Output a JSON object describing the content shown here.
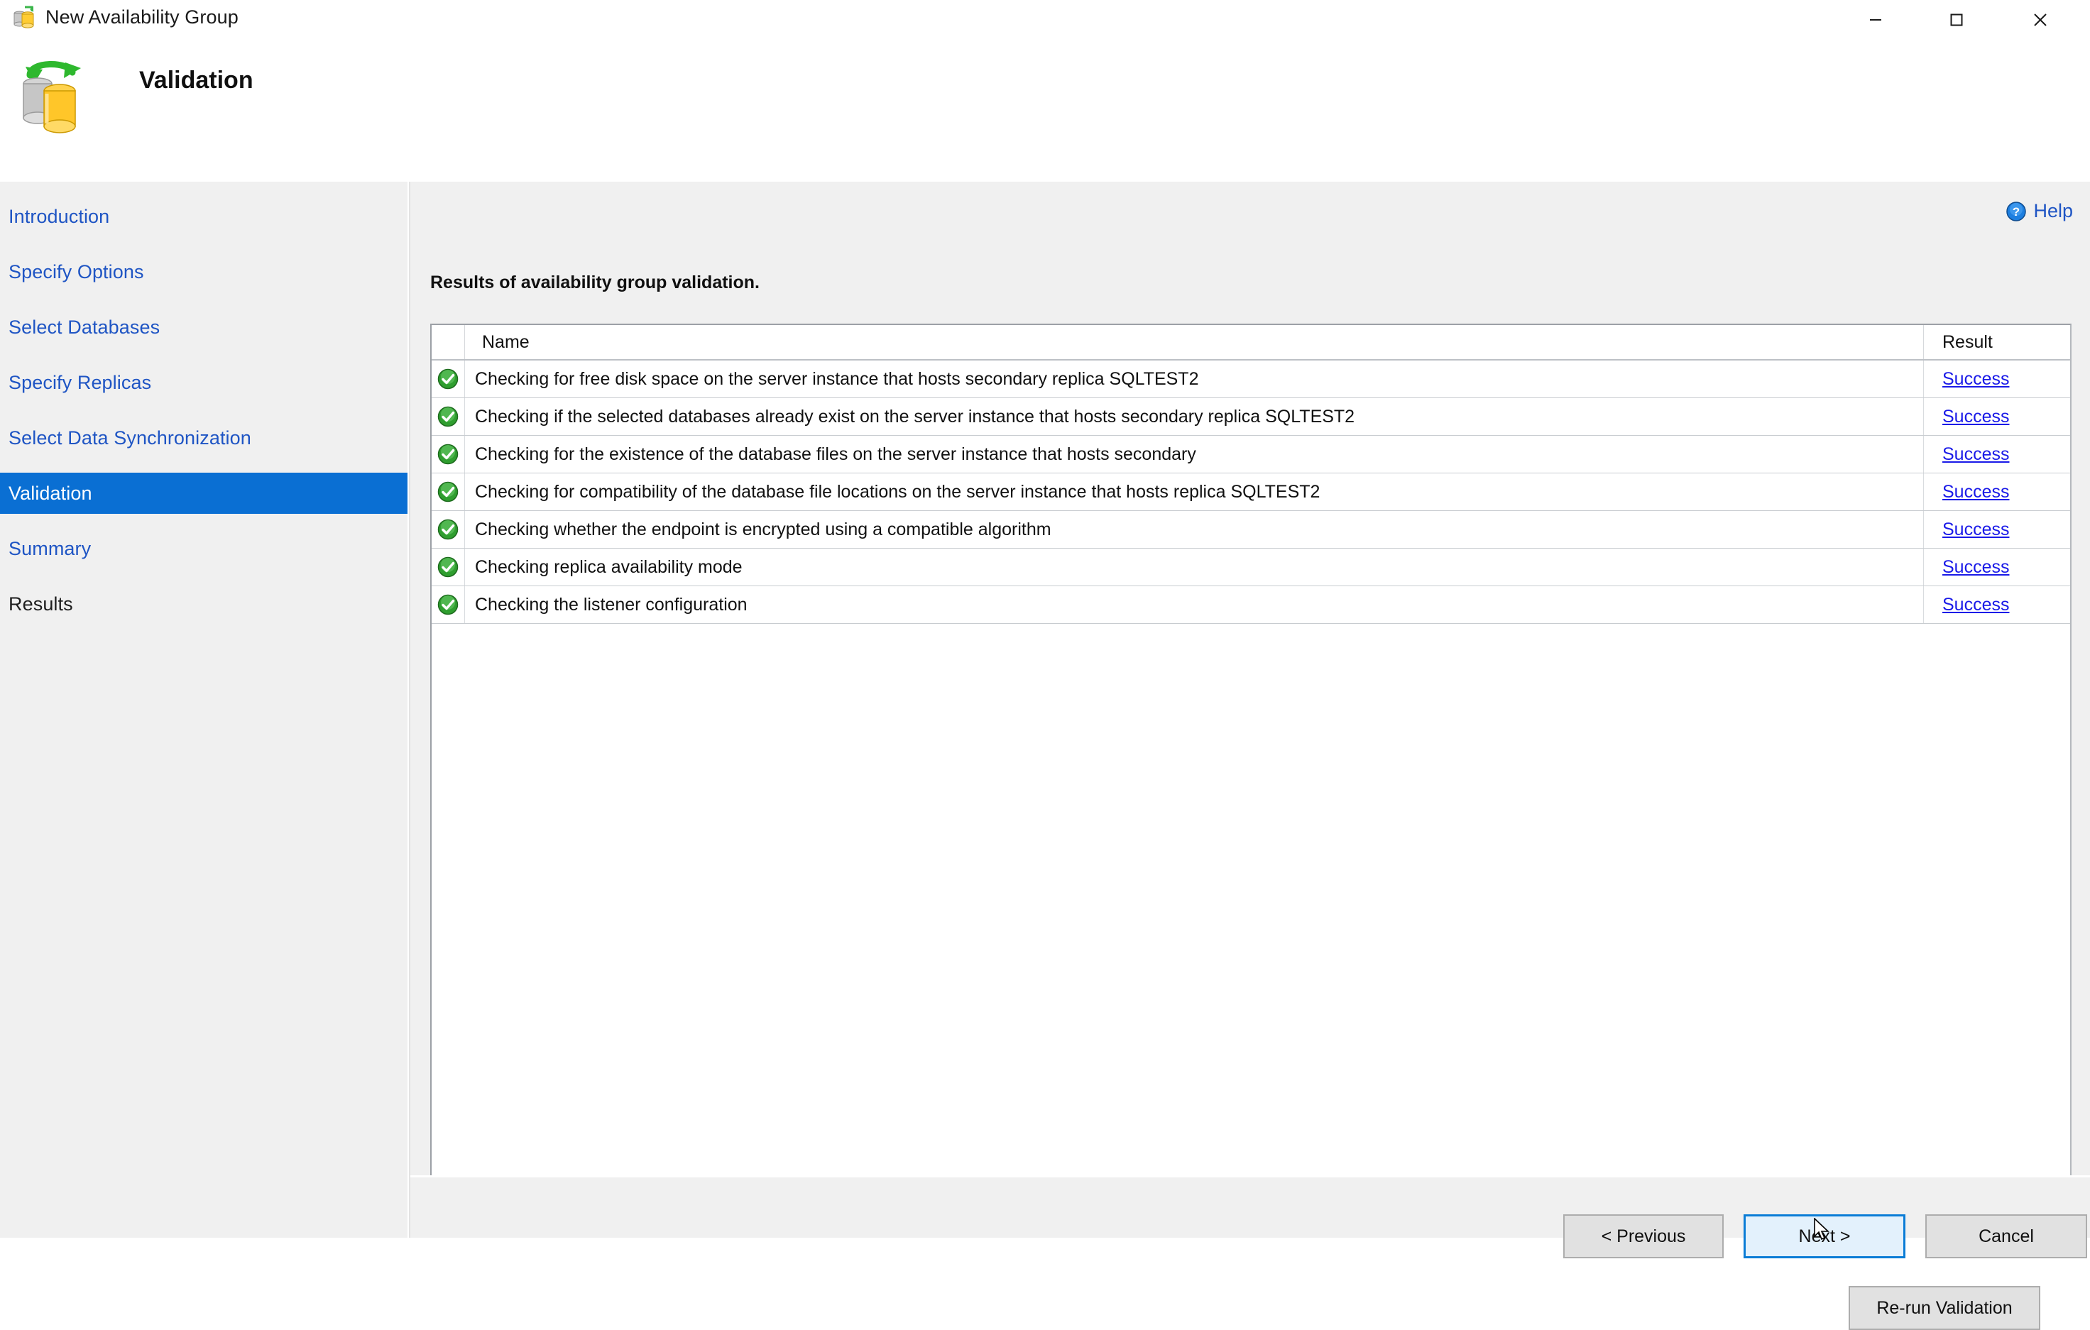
{
  "window": {
    "title": "New Availability Group",
    "icon": "availability-group-icon",
    "controls": {
      "minimize": "minimize-icon",
      "maximize": "maximize-icon",
      "close": "close-icon"
    }
  },
  "banner": {
    "title": "Validation",
    "icon": "database-replication-icon"
  },
  "sidebar": {
    "items": [
      {
        "label": "Introduction",
        "state": "link"
      },
      {
        "label": "Specify Options",
        "state": "link"
      },
      {
        "label": "Select Databases",
        "state": "link"
      },
      {
        "label": "Specify Replicas",
        "state": "link"
      },
      {
        "label": "Select Data Synchronization",
        "state": "link"
      },
      {
        "label": "Validation",
        "state": "active"
      },
      {
        "label": "Summary",
        "state": "link"
      },
      {
        "label": "Results",
        "state": "done"
      }
    ]
  },
  "content": {
    "help": {
      "label": "Help",
      "icon": "help-icon"
    },
    "section_title": "Results of availability group validation.",
    "table": {
      "columns": [
        "",
        "Name",
        "Result"
      ],
      "rows": [
        {
          "icon": "success-check-icon",
          "name": "Checking for free disk space on the server instance that hosts secondary replica SQLTEST2",
          "result": "Success"
        },
        {
          "icon": "success-check-icon",
          "name": "Checking if the selected databases already exist on the server instance that hosts secondary replica SQLTEST2",
          "result": "Success"
        },
        {
          "icon": "success-check-icon",
          "name": "Checking for the existence of the database files on the server instance that hosts secondary",
          "result": "Success"
        },
        {
          "icon": "success-check-icon",
          "name": "Checking for compatibility of the database file locations on the server instance that hosts replica SQLTEST2",
          "result": "Success"
        },
        {
          "icon": "success-check-icon",
          "name": "Checking whether the endpoint is encrypted using a compatible algorithm",
          "result": "Success"
        },
        {
          "icon": "success-check-icon",
          "name": "Checking replica availability mode",
          "result": "Success"
        },
        {
          "icon": "success-check-icon",
          "name": "Checking the listener configuration",
          "result": "Success"
        }
      ]
    },
    "rerun_button": "Re-run Validation"
  },
  "footer": {
    "previous": "< Previous",
    "next": "Next >",
    "cancel": "Cancel"
  },
  "colors": {
    "accent": "#0a6fd3",
    "link": "#1f55c4",
    "result_link": "#1a1ae8",
    "success": "#3aa13a",
    "window_bg": "#f0f0f0",
    "next_border": "#0a7cd6",
    "next_fill": "#e3f1fc"
  }
}
